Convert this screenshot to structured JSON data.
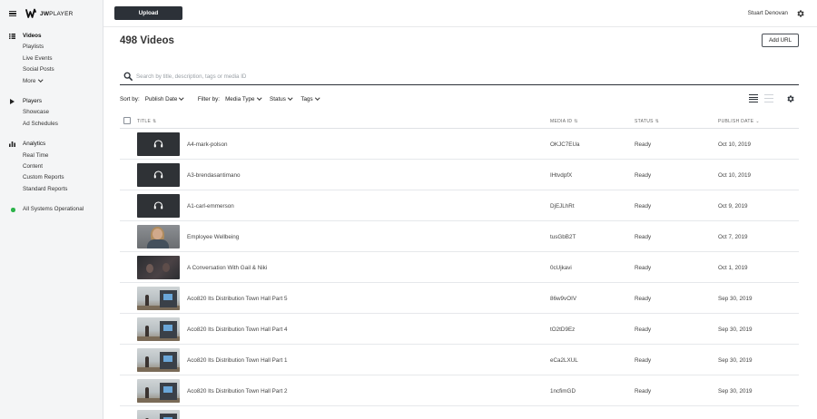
{
  "app": {
    "brand": "JWPLAYER",
    "brand_strong": "JW",
    "brand_light": "PLAYER"
  },
  "sidebar": {
    "groups": [
      {
        "items": [
          {
            "label": "Videos",
            "icon": "grid-icon",
            "active": true
          },
          {
            "label": "Playlists"
          },
          {
            "label": "Live Events"
          },
          {
            "label": "Social Posts"
          },
          {
            "label": "More",
            "chevron": true
          }
        ]
      },
      {
        "items": [
          {
            "label": "Players",
            "icon": "play-icon"
          },
          {
            "label": "Showcase"
          },
          {
            "label": "Ad Schedules"
          }
        ]
      },
      {
        "items": [
          {
            "label": "Analytics",
            "icon": "bar-chart-icon"
          },
          {
            "label": "Real Time"
          },
          {
            "label": "Content"
          },
          {
            "label": "Custom Reports"
          },
          {
            "label": "Standard Reports"
          }
        ]
      }
    ],
    "status": "All Systems Operational",
    "status_color": "#2cb34a"
  },
  "header": {
    "upload_label": "Upload",
    "user_name": "Stuart Denovan"
  },
  "main": {
    "title": "498 Videos",
    "add_url_label": "Add URL",
    "search_placeholder": "Search by title, description, tags or media ID",
    "sort_label": "Sort by:",
    "sort_value": "Publish Date",
    "filter_label": "Filter by:",
    "filters": [
      "Media Type",
      "Status",
      "Tags"
    ]
  },
  "table": {
    "columns": [
      "TITLE",
      "MEDIA ID",
      "STATUS",
      "PUBLISH DATE"
    ],
    "rows": [
      {
        "thumb": "audio",
        "title": "A4-mark-polson",
        "media_id": "OKJC7EUa",
        "status": "Ready",
        "date": "Oct 10, 2019"
      },
      {
        "thumb": "audio",
        "title": "A3-brendasantimano",
        "media_id": "IHtvdpfX",
        "status": "Ready",
        "date": "Oct 10, 2019"
      },
      {
        "thumb": "audio",
        "title": "A1-carl-emmerson",
        "media_id": "DjEJLhRt",
        "status": "Ready",
        "date": "Oct 9, 2019"
      },
      {
        "thumb": "person",
        "title": "Employee Wellbeing",
        "media_id": "tusGbB2T",
        "status": "Ready",
        "date": "Oct 7, 2019"
      },
      {
        "thumb": "dark",
        "title": "A Conversation With Gail & Niki",
        "media_id": "0cUjkavi",
        "status": "Ready",
        "date": "Oct 1, 2019"
      },
      {
        "thumb": "hall",
        "title": "Aco820 Its Distribution Town Hall Part 5",
        "media_id": "86w9vOIV",
        "status": "Ready",
        "date": "Sep 30, 2019"
      },
      {
        "thumb": "hall",
        "title": "Aco820 Its Distribution Town Hall Part 4",
        "media_id": "tO2tD9Ez",
        "status": "Ready",
        "date": "Sep 30, 2019"
      },
      {
        "thumb": "hall",
        "title": "Aco820 Its Distribution Town Hall Part 1",
        "media_id": "eCa2LXUL",
        "status": "Ready",
        "date": "Sep 30, 2019"
      },
      {
        "thumb": "hall",
        "title": "Aco820 Its Distribution Town Hall Part 2",
        "media_id": "1ncfimGD",
        "status": "Ready",
        "date": "Sep 30, 2019"
      },
      {
        "thumb": "hall",
        "title": "",
        "media_id": "",
        "status": "",
        "date": ""
      }
    ]
  }
}
